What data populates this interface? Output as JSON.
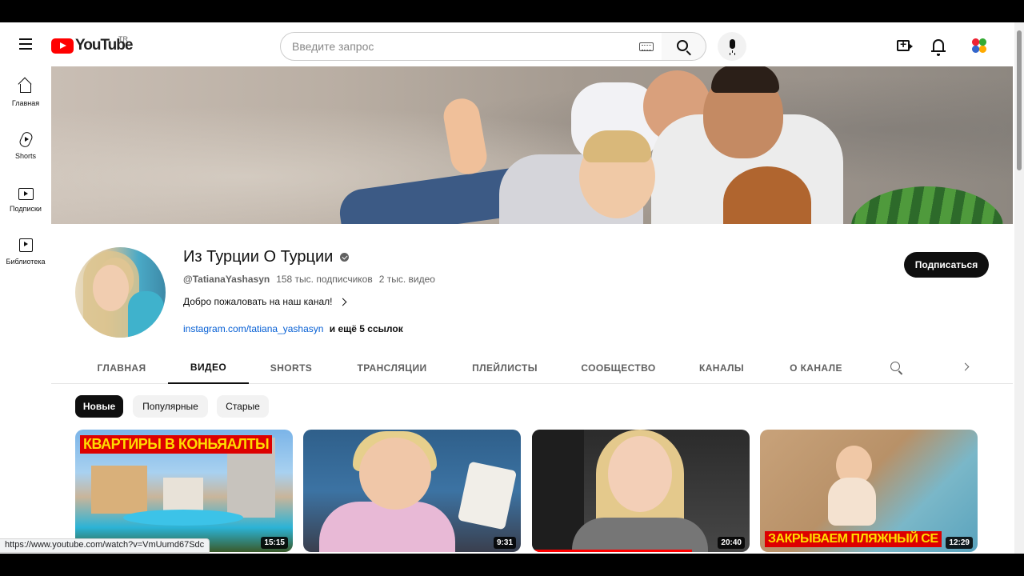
{
  "header": {
    "logo_text": "YouTube",
    "region": "TR",
    "search_placeholder": "Введите запрос"
  },
  "sidebar": {
    "items": [
      {
        "label": "Главная",
        "icon": "home-icon"
      },
      {
        "label": "Shorts",
        "icon": "shorts-icon"
      },
      {
        "label": "Подписки",
        "icon": "subscriptions-icon"
      },
      {
        "label": "Библиотека",
        "icon": "library-icon"
      }
    ]
  },
  "channel": {
    "title": "Из Турции О Турции",
    "handle": "@TatianaYashasyn",
    "subscribers": "158 тыс. подписчиков",
    "videos": "2 тыс. видео",
    "description": "Добро пожаловать на наш канал!",
    "link": "instagram.com/tatiana_yashasyn",
    "more_links": "и ещё 5 ссылок",
    "subscribe_label": "Подписаться"
  },
  "tabs": [
    {
      "label": "ГЛАВНАЯ",
      "active": false
    },
    {
      "label": "ВИДЕО",
      "active": true
    },
    {
      "label": "SHORTS",
      "active": false
    },
    {
      "label": "ТРАНСЛЯЦИИ",
      "active": false
    },
    {
      "label": "ПЛЕЙЛИСТЫ",
      "active": false
    },
    {
      "label": "СООБЩЕСТВО",
      "active": false
    },
    {
      "label": "КАНАЛЫ",
      "active": false
    },
    {
      "label": "О КАНАЛЕ",
      "active": false
    }
  ],
  "chips": [
    {
      "label": "Новые",
      "active": true
    },
    {
      "label": "Популярные",
      "active": false
    },
    {
      "label": "Старые",
      "active": false
    }
  ],
  "videos": [
    {
      "headline": "КВАРТИРЫ В КОНЬЯАЛТЫ",
      "headline_bottom": "",
      "duration": "15:15"
    },
    {
      "headline": "",
      "headline_bottom": "",
      "duration": "9:31"
    },
    {
      "headline": "",
      "headline_bottom": "",
      "duration": "20:40"
    },
    {
      "headline": "",
      "headline_bottom": "ЗАКРЫВАЕМ ПЛЯЖНЫЙ СЕ",
      "duration": "12:29"
    }
  ],
  "status_url": "https://www.youtube.com/watch?v=VmUumd67Sdc",
  "colors": {
    "brand_red": "#ff0000",
    "link_blue": "#065fd4",
    "text_primary": "#0f0f0f",
    "text_secondary": "#606060"
  }
}
